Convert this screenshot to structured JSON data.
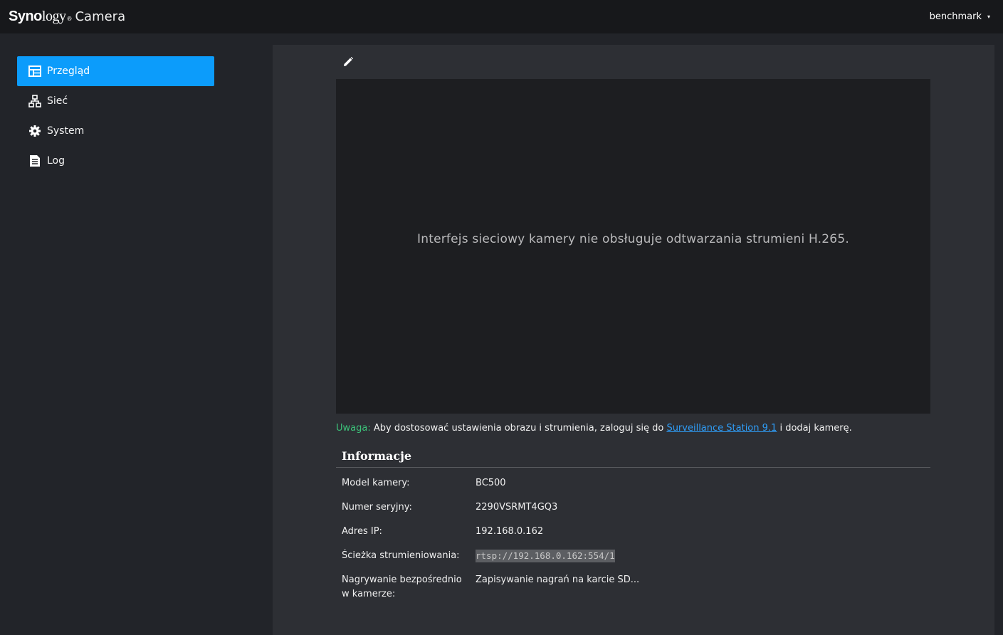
{
  "header": {
    "brand_bold": "Syno",
    "brand_light": "logy",
    "brand_reg": "®",
    "app_name": "Camera",
    "user_name": "benchmark",
    "user_caret": "▾"
  },
  "sidebar": {
    "items": [
      {
        "label": "Przegląd",
        "icon": "overview-icon",
        "active": true
      },
      {
        "label": "Sieć",
        "icon": "network-icon",
        "active": false
      },
      {
        "label": "System",
        "icon": "gear-icon",
        "active": false
      },
      {
        "label": "Log",
        "icon": "log-icon",
        "active": false
      }
    ]
  },
  "main": {
    "video_message": "Interfejs sieciowy kamery nie obsługuje odtwarzania strumieni H.265.",
    "note": {
      "prefix": "Uwaga:",
      "text_before": " Aby dostosować ustawienia obrazu i strumienia, zaloguj się do ",
      "link": "Surveillance Station 9.1",
      "text_after": " i dodaj kamerę."
    },
    "info": {
      "title": "Informacje",
      "rows": [
        {
          "label": "Model kamery:",
          "value": "BC500"
        },
        {
          "label": "Numer seryjny:",
          "value": "2290VSRMT4GQ3"
        },
        {
          "label": "Adres IP:",
          "value": "192.168.0.162"
        },
        {
          "label": "Ścieżka strumieniowania:",
          "value": "rtsp://192.168.0.162:554/1"
        },
        {
          "label": "Nagrywanie bezpośrednio w kamerze:",
          "value": "Zapisywanie nagrań na karcie SD..."
        }
      ]
    }
  },
  "colors": {
    "accent": "#0c9cfb",
    "warning": "#3cc37a",
    "link": "#2f9df7"
  }
}
